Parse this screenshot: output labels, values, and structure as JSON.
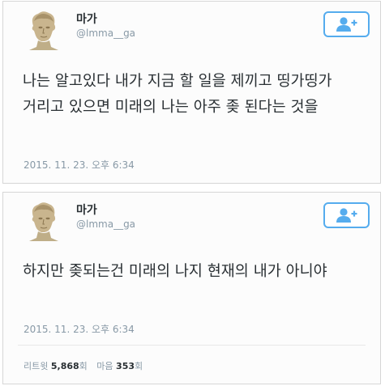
{
  "tweets": [
    {
      "author": {
        "name": "마가",
        "handle": "@lmma__ga",
        "avatar_icon": "marble-bust-avatar"
      },
      "follow_icon": "add-user-icon",
      "text": "나는 알고있다 내가 지금 할 일을 제끼고 띵가띵가 거리고 있으면 미래의 나는 아주 좆 된다는 것을",
      "timestamp": "2015. 11. 23. 오후 6:34"
    },
    {
      "author": {
        "name": "마가",
        "handle": "@lmma__ga",
        "avatar_icon": "marble-bust-avatar"
      },
      "follow_icon": "add-user-icon",
      "text": "하지만 좆되는건 미래의 나지 현재의 내가 아니야",
      "timestamp": "2015. 11. 23. 오후 6:34",
      "stats": {
        "retweets_label": "리트윗",
        "retweets_count": "5,868",
        "retweets_unit": "회",
        "likes_label": "마음",
        "likes_count": "353",
        "likes_unit": "회"
      }
    }
  ],
  "colors": {
    "accent": "#55acee",
    "text": "#292f33",
    "muted": "#8899a6"
  }
}
